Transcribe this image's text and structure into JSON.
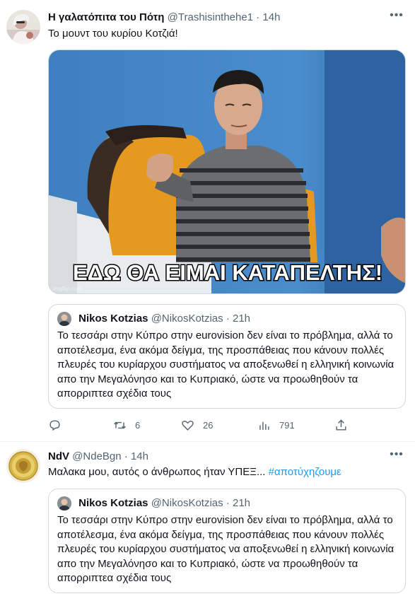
{
  "tweets": [
    {
      "display_name": "Η γαλατόπιτα του Πότη",
      "handle": "@Trashisinthehe1",
      "separator": "·",
      "time": "14h",
      "text": "Το μουντ του κυρίου Κοτζιά!",
      "media": {
        "caption": "ΕΔΩ ΘΑ ΕΙΜΑΙ ΚΑΤΑΠΕΛΤΗΣ!",
        "watermark": "imgflip.com"
      },
      "quote": {
        "display_name": "Nikos Kotzias",
        "handle": "@NikosKotzias",
        "separator": "·",
        "time": "21h",
        "text": "Το τεσσάρι στην Κύπρο στην eurovision δεν είναι το πρόβλημα, αλλά το αποτέλεσμα, ένα ακόμα δείγμα, της προσπάθειας που κάνουν πολλές πλευρές του κυρίαρχου συστήματος να αποξενωθεί η ελληνική κοινωνία απο την Μεγαλόνησο και το Κυπριακό, ώστε να προωθηθούν τα απορριπτεα σχέδια τους"
      },
      "actions": {
        "reply": "",
        "retweets": "6",
        "likes": "26",
        "views": "791"
      }
    },
    {
      "display_name": "NdV",
      "handle": "@NdeBgn",
      "separator": "·",
      "time": "14h",
      "text": "Μαλακα μου, αυτός ο άνθρωπος ήταν ΥΠΕΞ...",
      "hashtag": "#αποτύχηζουμε",
      "quote": {
        "display_name": "Nikos Kotzias",
        "handle": "@NikosKotzias",
        "separator": "·",
        "time": "21h",
        "text": "Το τεσσάρι στην Κύπρο στην eurovision δεν είναι το πρόβλημα, αλλά το αποτέλεσμα, ένα ακόμα δείγμα, της προσπάθειας που κάνουν πολλές πλευρές του κυρίαρχου συστήματος να αποξενωθεί η ελληνική κοινωνία απο την Μεγαλόνησο και το Κυπριακό, ώστε να προωθηθούν τα απορριπτεα σχέδια τους"
      }
    }
  ],
  "icons": {
    "more": "more-horizontal-icon",
    "reply": "reply-icon",
    "retweet": "retweet-icon",
    "like": "heart-icon",
    "views": "analytics-icon",
    "share": "share-icon"
  },
  "colors": {
    "link": "#1d9bf0",
    "secondary_text": "#536471",
    "border": "#cfd9de"
  }
}
